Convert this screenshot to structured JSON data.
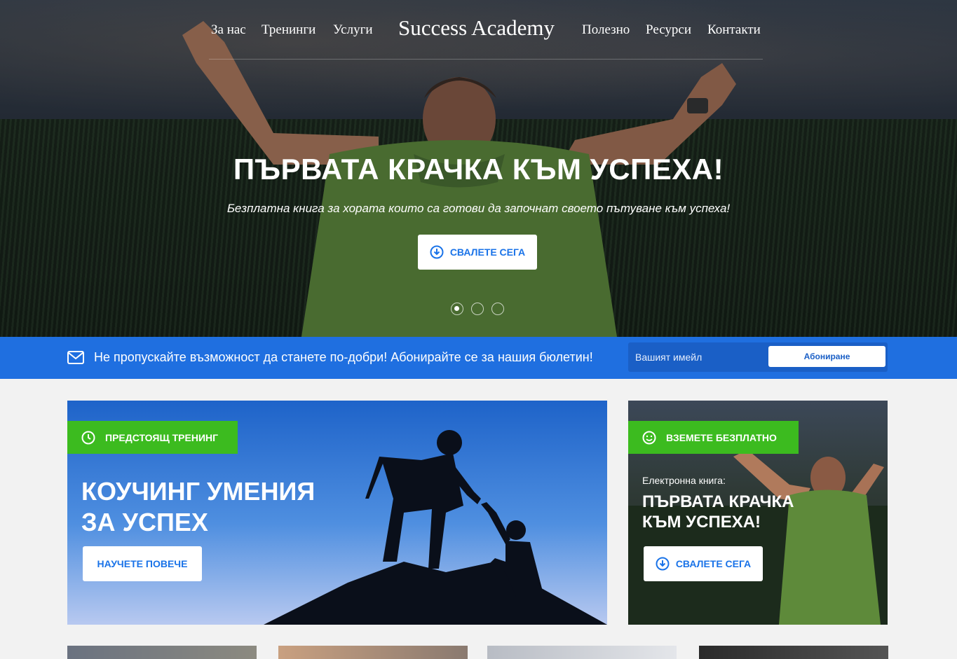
{
  "nav": {
    "left_links": [
      "За нас",
      "Тренинги",
      "Услуги"
    ],
    "brand": "Success Academy",
    "right_links": [
      "Полезно",
      "Ресурси",
      "Контакти"
    ]
  },
  "hero": {
    "title": "ПЪРВАТА КРАЧКА КЪМ УСПЕХА!",
    "subtitle": "Безплатна книга за хората които са готови да започнат своето пътуване към успеха!",
    "button_label": "СВАЛЕТЕ СЕГА",
    "slides": 3,
    "active_slide": 1
  },
  "newsletter": {
    "text": "Не пропускайте възможност да станете по-добри! Абонирайте се за нашия бюлетин!",
    "input_placeholder": "Вашият имейл",
    "button_label": "Абониране"
  },
  "card_training": {
    "tag": "ПРЕДСТОЯЩ ТРЕНИНГ",
    "title_line1": "КОУЧИНГ УМЕНИЯ",
    "title_line2": "ЗА УСПЕХ",
    "button_label": "НАУЧЕТЕ ПОВЕЧЕ"
  },
  "card_free": {
    "tag": "ВЗЕМЕТЕ БЕЗПЛАТНО",
    "kicker": "Електронна книга:",
    "title_line1": "ПЪРВАТА КРАЧКА",
    "title_line2": "КЪМ УСПЕХА!",
    "button_label": "СВАЛЕТЕ СЕГА"
  },
  "colors": {
    "accent_blue": "#1f6fe0",
    "accent_green": "#3cbb1f",
    "button_text": "#1a73e8"
  }
}
